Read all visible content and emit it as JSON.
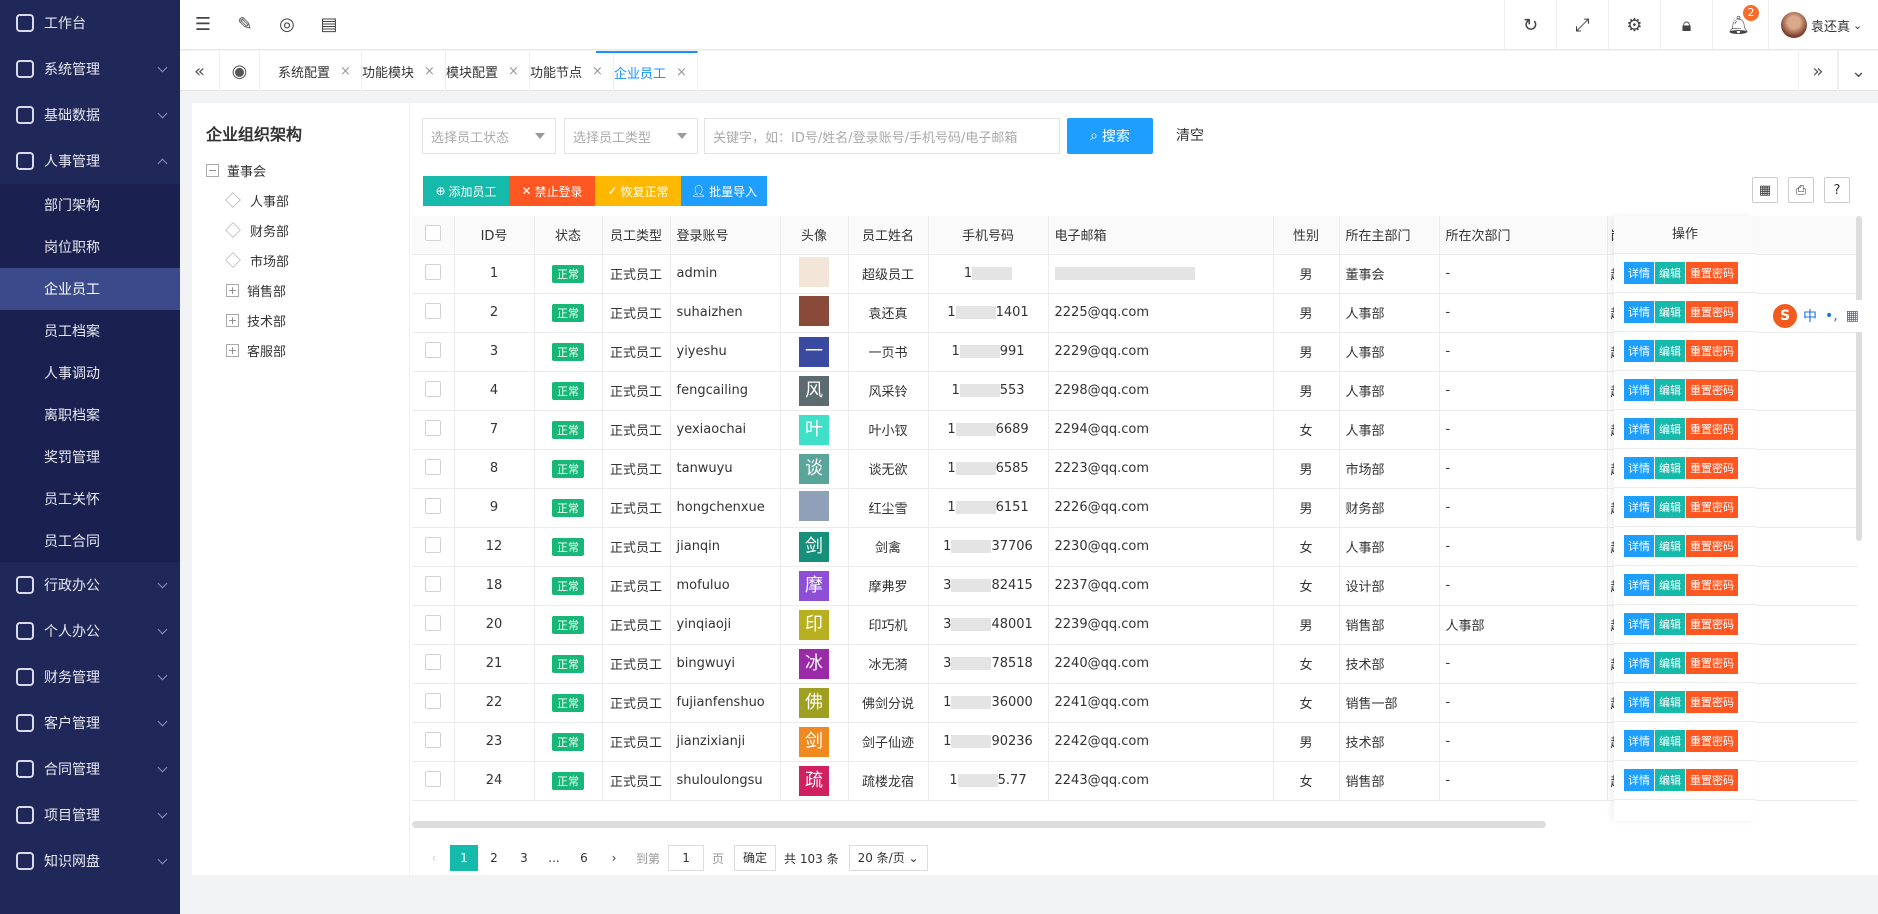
{
  "sidebar": {
    "items": [
      {
        "label": "工作台",
        "arrow": false
      },
      {
        "label": "系统管理",
        "arrow": true
      },
      {
        "label": "基础数据",
        "arrow": true
      },
      {
        "label": "人事管理",
        "arrow": true,
        "open": true
      }
    ],
    "sub": [
      "部门架构",
      "岗位职称",
      "企业员工",
      "员工档案",
      "人事调动",
      "离职档案",
      "奖罚管理",
      "员工关怀",
      "员工合同"
    ],
    "active_sub": "企业员工",
    "after": [
      "行政办公",
      "个人办公",
      "财务管理",
      "客户管理",
      "合同管理",
      "项目管理",
      "知识网盘"
    ]
  },
  "topbar": {
    "user": "袁还真",
    "notifications": "2"
  },
  "tabs": [
    "系统配置",
    "功能模块",
    "模块配置",
    "功能节点",
    "企业员工"
  ],
  "active_tab": "企业员工",
  "tree": {
    "title": "企业组织架构",
    "root": "董事会",
    "children": [
      {
        "label": "人事部",
        "expandable": false
      },
      {
        "label": "财务部",
        "expandable": false
      },
      {
        "label": "市场部",
        "expandable": false
      },
      {
        "label": "销售部",
        "expandable": true
      },
      {
        "label": "技术部",
        "expandable": true
      },
      {
        "label": "客服部",
        "expandable": true
      }
    ]
  },
  "filters": {
    "status_placeholder": "选择员工状态",
    "type_placeholder": "选择员工类型",
    "keyword_placeholder": "关键字，如：ID号/姓名/登录账号/手机号码/电子邮箱",
    "search": "搜索",
    "clear": "清空"
  },
  "actions": {
    "add": "添加员工",
    "disable": "禁止登录",
    "restore": "恢复正常",
    "import": "批量导入"
  },
  "table": {
    "headers": [
      "ID号",
      "状态",
      "员工类型",
      "登录账号",
      "头像",
      "员工姓名",
      "手机号码",
      "电子邮箱",
      "性别",
      "所在主部门",
      "所在次部门",
      "岗",
      "操作"
    ],
    "ops": [
      "详情",
      "编辑",
      "重置密码"
    ],
    "rows": [
      {
        "id": "1",
        "status": "正常",
        "type": "正式员工",
        "account": "admin",
        "av": "",
        "avc": "#f3e6d8",
        "name": "超级员工",
        "p1": "1",
        "p2": "",
        "email": "",
        "sex": "男",
        "dept": "董事会",
        "dept2": "-",
        "pos": "超"
      },
      {
        "id": "2",
        "status": "正常",
        "type": "正式员工",
        "account": "suhaizhen",
        "av": "",
        "avc": "#8a4a3a",
        "name": "袁还真",
        "p1": "1",
        "p2": "1401",
        "email": "2225@qq.com",
        "sex": "男",
        "dept": "人事部",
        "dept2": "-",
        "pos": "超"
      },
      {
        "id": "3",
        "status": "正常",
        "type": "正式员工",
        "account": "yiyeshu",
        "av": "一",
        "avc": "#3a4aa0",
        "name": "一页书",
        "p1": "1",
        "p2": "991",
        "email": "2229@qq.com",
        "sex": "男",
        "dept": "人事部",
        "dept2": "-",
        "pos": "超"
      },
      {
        "id": "4",
        "status": "正常",
        "type": "正式员工",
        "account": "fengcailing",
        "av": "风",
        "avc": "#5b6b70",
        "name": "风采铃",
        "p1": "1",
        "p2": "553",
        "email": "2298@qq.com",
        "sex": "男",
        "dept": "人事部",
        "dept2": "-",
        "pos": "超"
      },
      {
        "id": "7",
        "status": "正常",
        "type": "正式员工",
        "account": "yexiaochai",
        "av": "叶",
        "avc": "#3ee0c8",
        "name": "叶小钗",
        "p1": "1",
        "p2": "6689",
        "email": "2294@qq.com",
        "sex": "女",
        "dept": "人事部",
        "dept2": "-",
        "pos": "超"
      },
      {
        "id": "8",
        "status": "正常",
        "type": "正式员工",
        "account": "tanwuyu",
        "av": "谈",
        "avc": "#5aa59a",
        "name": "谈无欲",
        "p1": "1",
        "p2": "6585",
        "email": "2223@qq.com",
        "sex": "男",
        "dept": "市场部",
        "dept2": "-",
        "pos": "超"
      },
      {
        "id": "9",
        "status": "正常",
        "type": "正式员工",
        "account": "hongchenxue",
        "av": "",
        "avc": "#8fa0b8",
        "name": "红尘雪",
        "p1": "1",
        "p2": "6151",
        "email": "2226@qq.com",
        "sex": "男",
        "dept": "财务部",
        "dept2": "-",
        "pos": "超"
      },
      {
        "id": "12",
        "status": "正常",
        "type": "正式员工",
        "account": "jianqin",
        "av": "剑",
        "avc": "#16907a",
        "name": "剑禽",
        "p1": "1",
        "p2": "37706",
        "email": "2230@qq.com",
        "sex": "女",
        "dept": "人事部",
        "dept2": "-",
        "pos": "超"
      },
      {
        "id": "18",
        "status": "正常",
        "type": "正式员工",
        "account": "mofuluo",
        "av": "摩",
        "avc": "#8e4ed8",
        "name": "摩弗罗",
        "p1": "3",
        "p2": "82415",
        "email": "2237@qq.com",
        "sex": "女",
        "dept": "设计部",
        "dept2": "-",
        "pos": "超"
      },
      {
        "id": "20",
        "status": "正常",
        "type": "正式员工",
        "account": "yinqiaoji",
        "av": "印",
        "avc": "#b8b020",
        "name": "印巧机",
        "p1": "3",
        "p2": "48001",
        "email": "2239@qq.com",
        "sex": "男",
        "dept": "销售部",
        "dept2": "人事部",
        "pos": "超"
      },
      {
        "id": "21",
        "status": "正常",
        "type": "正式员工",
        "account": "bingwuyi",
        "av": "冰",
        "avc": "#9b2aa8",
        "name": "冰无漪",
        "p1": "3",
        "p2": "78518",
        "email": "2240@qq.com",
        "sex": "女",
        "dept": "技术部",
        "dept2": "-",
        "pos": "超"
      },
      {
        "id": "22",
        "status": "正常",
        "type": "正式员工",
        "account": "fujianfenshuo",
        "av": "佛",
        "avc": "#a0a020",
        "name": "佛剑分说",
        "p1": "1",
        "p2": "36000",
        "email": "2241@qq.com",
        "sex": "女",
        "dept": "销售一部",
        "dept2": "-",
        "pos": "超"
      },
      {
        "id": "23",
        "status": "正常",
        "type": "正式员工",
        "account": "jianzixianji",
        "av": "剑",
        "avc": "#f08a20",
        "name": "剑子仙迹",
        "p1": "1",
        "p2": "90236",
        "email": "2242@qq.com",
        "sex": "男",
        "dept": "技术部",
        "dept2": "-",
        "pos": "超"
      },
      {
        "id": "24",
        "status": "正常",
        "type": "正式员工",
        "account": "shuloulongsu",
        "av": "疏",
        "avc": "#d02060",
        "name": "疏楼龙宿",
        "p1": "1",
        "p2": "5.77",
        "email": "2243@qq.com",
        "sex": "女",
        "dept": "销售部",
        "dept2": "-",
        "pos": "超"
      }
    ]
  },
  "pager": {
    "pages": [
      "1",
      "2",
      "3",
      "...",
      "6"
    ],
    "goto": "到第",
    "page_value": "1",
    "page_unit": "页",
    "confirm": "确定",
    "total": "共 103 条",
    "size": "20 条/页"
  },
  "ime": {
    "label": "中"
  },
  "colors": {
    "sidebar": "#20285a",
    "accent": "#16baaa",
    "search": "#1e9fff",
    "detail": "#1e9fff",
    "edit": "#16baaa",
    "reset": "#ff5722"
  }
}
